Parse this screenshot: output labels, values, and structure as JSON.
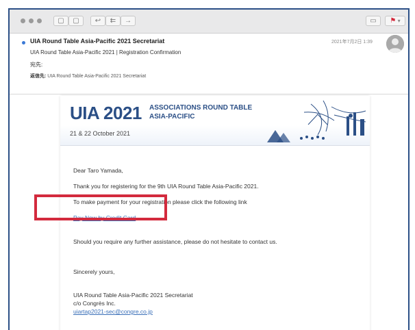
{
  "email": {
    "sender": "UIA Round Table Asia-Pacific 2021 Secretariat",
    "subject": "UIA Round Table Asia-Pacific 2021 | Registration Confirmation",
    "to_label": "宛先:",
    "cc_label": "返信先:",
    "cc_value": "UIA Round Table Asia-Pacific 2021 Secretariat",
    "date": "2021年7月2日 1:39"
  },
  "banner": {
    "brand": "UIA 2021",
    "event_line1": "ASSOCIATIONS ROUND TABLE",
    "event_line2": "ASIA-PACIFIC",
    "dates": "21 & 22 October 2021"
  },
  "body": {
    "greeting": "Dear Taro Yamada,",
    "line1": "Thank you for registering for the 9th UIA Round Table Asia-Pacific 2021.",
    "line2": "To make payment for your registration please click the following link",
    "pay_link": "Pay Now by Credit Card",
    "line3": "Should you require any further assistance, please do not hesitate to contact us.",
    "closing": "Sincerely yours,",
    "sig1": "UIA Round Table Asia-Pacific 2021 Secretariat",
    "sig2": "c/o Congrès Inc.",
    "sig_email": "uiartap2021-sec@congre.co.jp"
  },
  "colors": {
    "highlight": "#d32a3d",
    "brand_blue": "#2b4f86",
    "link": "#3a6fb8"
  }
}
